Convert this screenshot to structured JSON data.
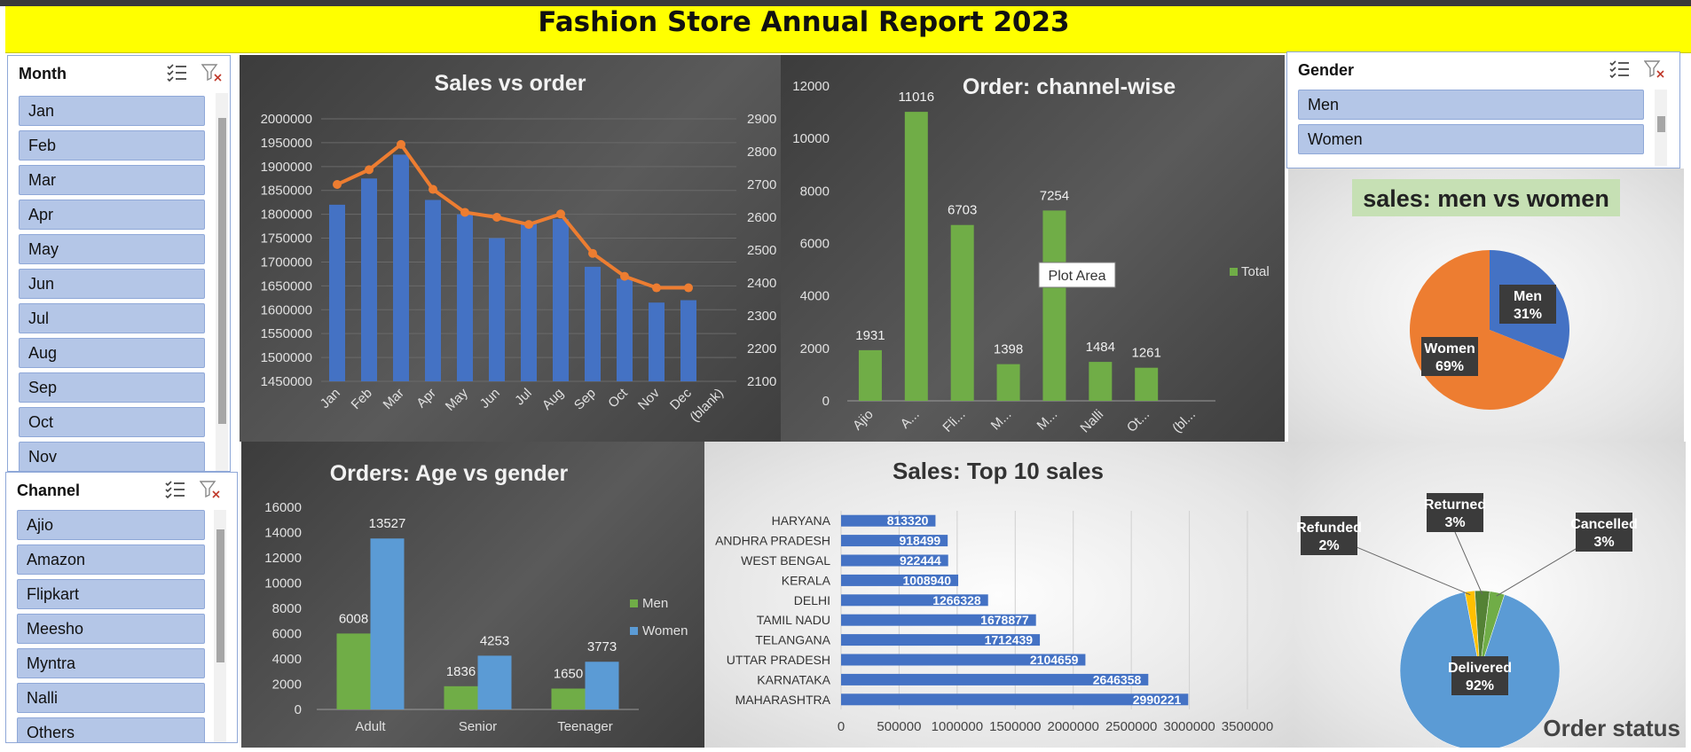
{
  "report": {
    "title": "Fashion Store Annual Report 2023"
  },
  "month_slicer": {
    "title": "Month",
    "items": [
      "Jan",
      "Feb",
      "Mar",
      "Apr",
      "May",
      "Jun",
      "Jul",
      "Aug",
      "Sep",
      "Oct",
      "Nov"
    ]
  },
  "channel_slicer": {
    "title": "Channel",
    "items": [
      "Ajio",
      "Amazon",
      "Flipkart",
      "Meesho",
      "Myntra",
      "Nalli",
      "Others"
    ]
  },
  "gender_slicer": {
    "title": "Gender",
    "items": [
      "Men",
      "Women"
    ]
  },
  "colors": {
    "bar_blue": "#4472c4",
    "line_orange": "#ed7d31",
    "bar_green": "#70ad47",
    "bar_lightblue": "#5b9bd5",
    "gold": "#ffc000",
    "dark_green": "#548235",
    "title_yellow": "#ffff00"
  },
  "tooltip": {
    "text": "Plot Area"
  },
  "chart_data": [
    {
      "id": "sales_vs_order",
      "type": "bar",
      "title": "Sales vs order",
      "categories": [
        "Jan",
        "Feb",
        "Mar",
        "Apr",
        "May",
        "Jun",
        "Jul",
        "Aug",
        "Sep",
        "Oct",
        "Nov",
        "Dec",
        "(blank)"
      ],
      "series": [
        {
          "values": [
            1820000,
            1875000,
            1925000,
            1830000,
            1800000,
            1750000,
            1780000,
            1790000,
            1690000,
            1665000,
            1615000,
            1620000,
            null
          ]
        },
        {
          "type": "line",
          "values": [
            2700,
            2745,
            2822,
            2685,
            2615,
            2600,
            2578,
            2610,
            2490,
            2420,
            2385,
            2385,
            null
          ]
        }
      ],
      "y_ticks": [
        "2000000",
        "1950000",
        "1900000",
        "1850000",
        "1800000",
        "1750000",
        "1700000",
        "1650000",
        "1600000",
        "1550000",
        "1500000",
        "1450000"
      ],
      "y2_ticks": [
        "2900",
        "2800",
        "2700",
        "2600",
        "2500",
        "2400",
        "2300",
        "2200",
        "2100"
      ],
      "ylim": [
        1450000,
        2000000
      ],
      "y2lim": [
        2100,
        2900
      ]
    },
    {
      "id": "order_channel",
      "type": "bar",
      "title": "Order: channel-wise",
      "categories": [
        "Ajio",
        "A...",
        "Fli...",
        "M...",
        "M...",
        "Nalli",
        "Ot...",
        "(bl..."
      ],
      "series": [
        {
          "name": "Total",
          "values": [
            1931,
            11016,
            6703,
            1398,
            7254,
            1484,
            1261,
            null
          ]
        }
      ],
      "y_ticks": [
        "12000",
        "10000",
        "8000",
        "6000",
        "4000",
        "2000",
        "0"
      ],
      "ylim": [
        0,
        12000
      ],
      "legend": "right"
    },
    {
      "id": "sales_gender",
      "type": "pie",
      "title": "sales: men vs women",
      "labels": [
        "Men",
        "Women"
      ],
      "values": [
        31,
        69
      ],
      "value_labels": [
        "31%",
        "69%"
      ]
    },
    {
      "id": "orders_age_gender",
      "type": "bar",
      "title": "Orders: Age vs gender",
      "categories": [
        "Adult",
        "Senior",
        "Teenager"
      ],
      "series": [
        {
          "name": "Men",
          "values": [
            6008,
            1836,
            1650
          ]
        },
        {
          "name": "Women",
          "values": [
            13527,
            4253,
            3773
          ]
        }
      ],
      "y_ticks": [
        "16000",
        "14000",
        "12000",
        "10000",
        "8000",
        "6000",
        "4000",
        "2000",
        "0"
      ],
      "ylim": [
        0,
        16000
      ],
      "legend": "right"
    },
    {
      "id": "top10_sales",
      "type": "bar",
      "orientation": "horizontal",
      "title": "Sales: Top 10 sales",
      "categories": [
        "HARYANA",
        "ANDHRA PRADESH",
        "WEST BENGAL",
        "KERALA",
        "DELHI",
        "TAMIL NADU",
        "TELANGANA",
        "UTTAR PRADESH",
        "KARNATAKA",
        "MAHARASHTRA"
      ],
      "values": [
        813320,
        918499,
        922444,
        1008940,
        1266328,
        1678877,
        1712439,
        2104659,
        2646358,
        2990221
      ],
      "x_ticks": [
        "0",
        "500000",
        "1000000",
        "1500000",
        "2000000",
        "2500000",
        "3000000",
        "3500000"
      ],
      "xlim": [
        0,
        3500000
      ]
    },
    {
      "id": "order_status",
      "type": "pie",
      "title": "Order status",
      "labels": [
        "Delivered",
        "Refunded",
        "Returned",
        "Cancelled"
      ],
      "values": [
        92,
        2,
        3,
        3
      ],
      "value_labels": [
        "92%",
        "2%",
        "3%",
        "3%"
      ]
    }
  ]
}
